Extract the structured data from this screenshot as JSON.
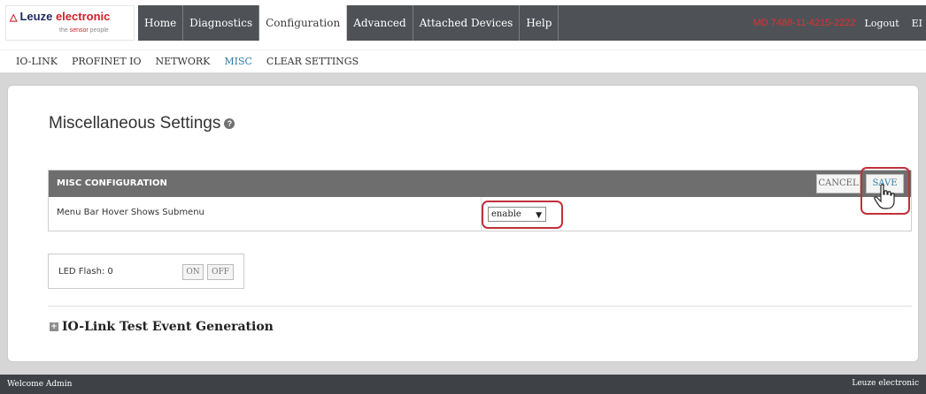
{
  "brand": {
    "name_part1": "Leuze",
    "name_part2": "electronic",
    "tagline_part1": "the",
    "tagline_part2": "sensor",
    "tagline_part3": "people"
  },
  "nav": {
    "tabs": [
      "Home",
      "Diagnostics",
      "Configuration",
      "Advanced",
      "Attached Devices",
      "Help"
    ],
    "active": "Configuration",
    "device_id": "MD 7488-11-4215-2222",
    "logout": "Logout",
    "language": "EI"
  },
  "subnav": {
    "items": [
      "IO-LINK",
      "PROFINET IO",
      "NETWORK",
      "MISC",
      "CLEAR SETTINGS"
    ],
    "active": "MISC"
  },
  "page": {
    "title": "Miscellaneous Settings"
  },
  "misc_config": {
    "header": "MISC CONFIGURATION",
    "cancel_label": "CANCEL",
    "save_label": "SAVE",
    "row_label": "Menu Bar Hover Shows Submenu",
    "hover_value": "enable"
  },
  "led": {
    "label": "LED Flash:",
    "value": "0",
    "on_label": "ON",
    "off_label": "OFF"
  },
  "io_link_event": {
    "title": "IO-Link Test Event Generation"
  },
  "footer": {
    "welcome": "Welcome Admin",
    "brand": "Leuze electronic"
  },
  "colors": {
    "nav_bg": "#4e5257",
    "accent": "#2e7fa7",
    "highlight": "#c0303a",
    "brand_red": "#d0202a",
    "brand_navy": "#1e2a5a"
  }
}
